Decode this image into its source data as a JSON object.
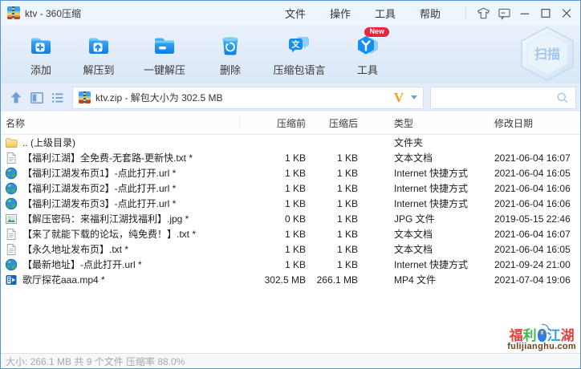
{
  "window": {
    "title": "ktv - 360压缩"
  },
  "menu": {
    "items": [
      "文件",
      "操作",
      "工具",
      "帮助"
    ]
  },
  "toolbar": {
    "buttons": [
      {
        "label": "添加",
        "icon": "folder-add-icon"
      },
      {
        "label": "解压到",
        "icon": "folder-extract-to-icon"
      },
      {
        "label": "一键解压",
        "icon": "folder-one-click-extract-icon"
      },
      {
        "label": "删除",
        "icon": "trash-recycle-icon"
      },
      {
        "label": "压缩包语言",
        "icon": "language-bubble-icon"
      },
      {
        "label": "工具",
        "icon": "tools-hexagon-icon",
        "badge": "New"
      }
    ],
    "scan_label": "扫描"
  },
  "addressbar": {
    "path": "ktv.zip - 解包大小为 302.5 MB",
    "vip_mark": "V"
  },
  "search": {
    "value": ""
  },
  "table": {
    "headers": {
      "name": "名称",
      "before": "压缩前",
      "after": "压缩后",
      "type": "类型",
      "date": "修改日期"
    },
    "rows": [
      {
        "icon": "folder-icon",
        "name": ".. (上级目录)",
        "before": "",
        "after": "",
        "type": "文件夹",
        "date": ""
      },
      {
        "icon": "text-file-icon",
        "name": "【福利江湖】全免费-无套路-更新快.txt *",
        "before": "1 KB",
        "after": "1 KB",
        "type": "文本文档",
        "date": "2021-06-04 16:07"
      },
      {
        "icon": "globe-icon",
        "name": "【福利江湖发布页1】-点此打开.url *",
        "before": "1 KB",
        "after": "1 KB",
        "type": "Internet 快捷方式",
        "date": "2021-06-04 16:05"
      },
      {
        "icon": "globe-icon",
        "name": "【福利江湖发布页2】-点此打开.url *",
        "before": "1 KB",
        "after": "1 KB",
        "type": "Internet 快捷方式",
        "date": "2021-06-04 16:06"
      },
      {
        "icon": "globe-icon",
        "name": "【福利江湖发布页3】-点此打开.url *",
        "before": "1 KB",
        "after": "1 KB",
        "type": "Internet 快捷方式",
        "date": "2021-06-04 16:06"
      },
      {
        "icon": "image-file-icon",
        "name": "【解压密码：来福利江湖找福利】.jpg *",
        "before": "0 KB",
        "after": "1 KB",
        "type": "JPG 文件",
        "date": "2019-05-15 22:46"
      },
      {
        "icon": "text-file-icon",
        "name": "【来了就能下载的论坛，纯免费！】.txt *",
        "before": "1 KB",
        "after": "1 KB",
        "type": "文本文档",
        "date": "2021-06-04 16:07"
      },
      {
        "icon": "text-file-icon",
        "name": "【永久地址发布页】.txt *",
        "before": "1 KB",
        "after": "1 KB",
        "type": "文本文档",
        "date": "2021-06-04 16:05"
      },
      {
        "icon": "globe-icon",
        "name": "【最新地址】-点此打开.url *",
        "before": "1 KB",
        "after": "1 KB",
        "type": "Internet 快捷方式",
        "date": "2021-09-24 21:00"
      },
      {
        "icon": "video-file-icon",
        "name": "歌厅探花aaa.mp4 *",
        "before": "302.5 MB",
        "after": "266.1 MB",
        "type": "MP4 文件",
        "date": "2021-07-04 19:06"
      }
    ]
  },
  "statusbar": {
    "text": "大小: 266.1 MB 共 9 个文件 压缩率 88.0%"
  },
  "watermark": {
    "chars": [
      {
        "t": "福",
        "c": "#e64340"
      },
      {
        "t": "利",
        "c": "#3eb650"
      },
      {
        "t": "mouse-icon"
      },
      {
        "t": "江",
        "c": "#2e9fe6"
      },
      {
        "t": "湖",
        "c": "#e64340"
      }
    ],
    "domain": "fulijianghu.com"
  },
  "colors": {
    "accent_blue": "#1590f2",
    "toolbar_bg": "#dde9f7",
    "vip_orange": "#f59b22",
    "badge_red": "#e5273e",
    "window_border": "#5796d2"
  }
}
